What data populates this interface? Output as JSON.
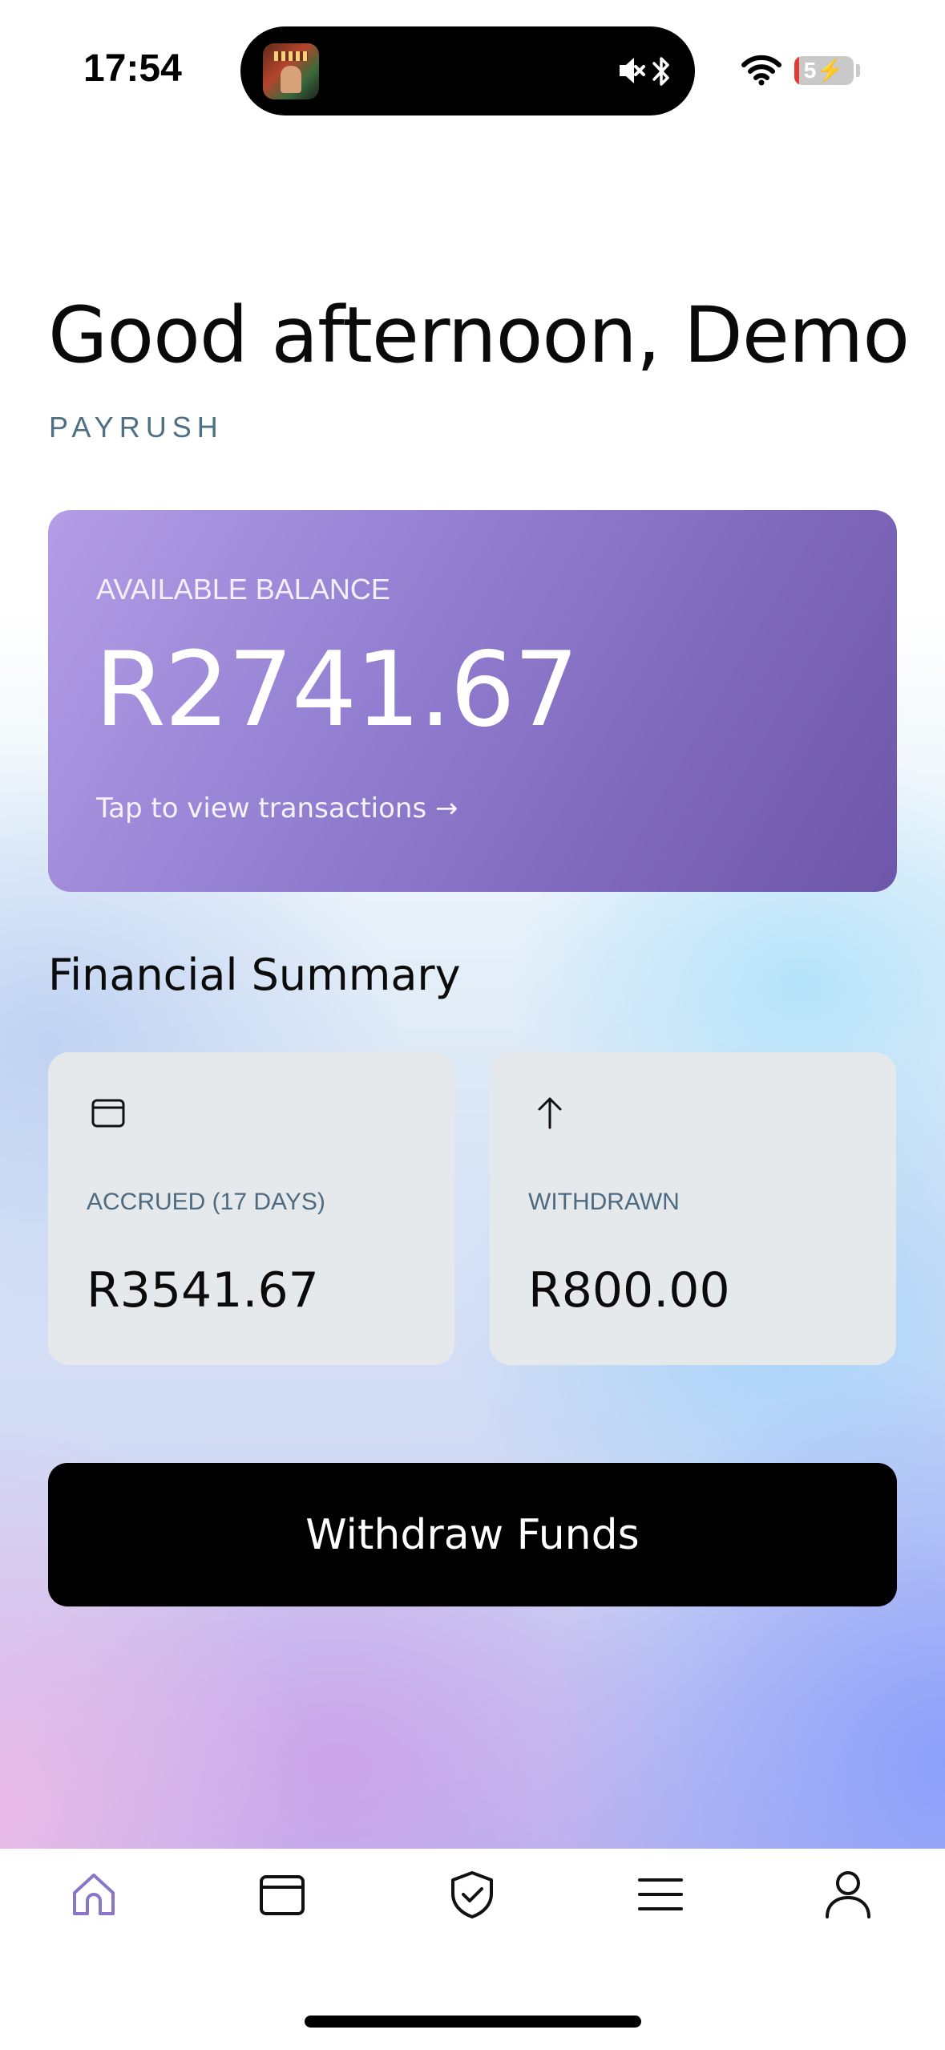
{
  "status_bar": {
    "time": "17:54",
    "battery_level": "5",
    "battery_fraction": 0.05,
    "icons": [
      "now-playing-art",
      "mute-icon",
      "bluetooth-icon",
      "wifi-icon",
      "battery-icon"
    ]
  },
  "header": {
    "greeting": "Good afternoon, Demo",
    "brand": "PAYRUSH"
  },
  "balance_card": {
    "label": "AVAILABLE BALANCE",
    "amount": "R2741.67",
    "link": "Tap to view transactions →",
    "gradient_colors": [
      "#b39de6",
      "#6e57a8"
    ]
  },
  "summary": {
    "title": "Financial Summary",
    "cards": [
      {
        "icon": "wallet-icon",
        "label": "ACCRUED (17 DAYS)",
        "value": "R3541.67"
      },
      {
        "icon": "arrow-up-icon",
        "label": "WITHDRAWN",
        "value": "R800.00"
      }
    ]
  },
  "actions": {
    "withdraw_label": "Withdraw Funds"
  },
  "tab_bar": {
    "items": [
      {
        "name": "home",
        "icon": "home-icon",
        "active": true,
        "color": "#8a76c8"
      },
      {
        "name": "wallet",
        "icon": "wallet-icon",
        "active": false
      },
      {
        "name": "security",
        "icon": "shield-check-icon",
        "active": false
      },
      {
        "name": "menu",
        "icon": "menu-icon",
        "active": false
      },
      {
        "name": "profile",
        "icon": "user-icon",
        "active": false
      }
    ]
  }
}
